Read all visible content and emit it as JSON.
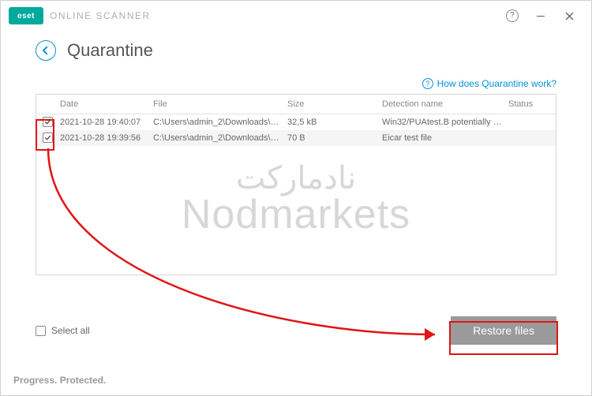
{
  "app": {
    "logo_text": "eset",
    "name": "ONLINE SCANNER"
  },
  "page": {
    "title": "Quarantine",
    "help_link": "How does Quarantine work?"
  },
  "table": {
    "headers": {
      "date": "Date",
      "file": "File",
      "size": "Size",
      "detection": "Detection name",
      "status": "Status"
    },
    "rows": [
      {
        "checked": true,
        "date": "2021-10-28 19:40:07",
        "file": "C:\\Users\\admin_2\\Downloads\\Po...",
        "size": "32,5 kB",
        "detection": "Win32/PUAtest.B potentially unw...",
        "status": ""
      },
      {
        "checked": true,
        "date": "2021-10-28 19:39:56",
        "file": "C:\\Users\\admin_2\\Downloads\\ei...",
        "size": "70 B",
        "detection": "Eicar test file",
        "status": ""
      }
    ]
  },
  "controls": {
    "select_all": "Select all",
    "restore": "Restore files"
  },
  "footer": "Progress. Protected.",
  "watermark": {
    "ar": "نادمارکت",
    "en": "Nodmarkets"
  }
}
